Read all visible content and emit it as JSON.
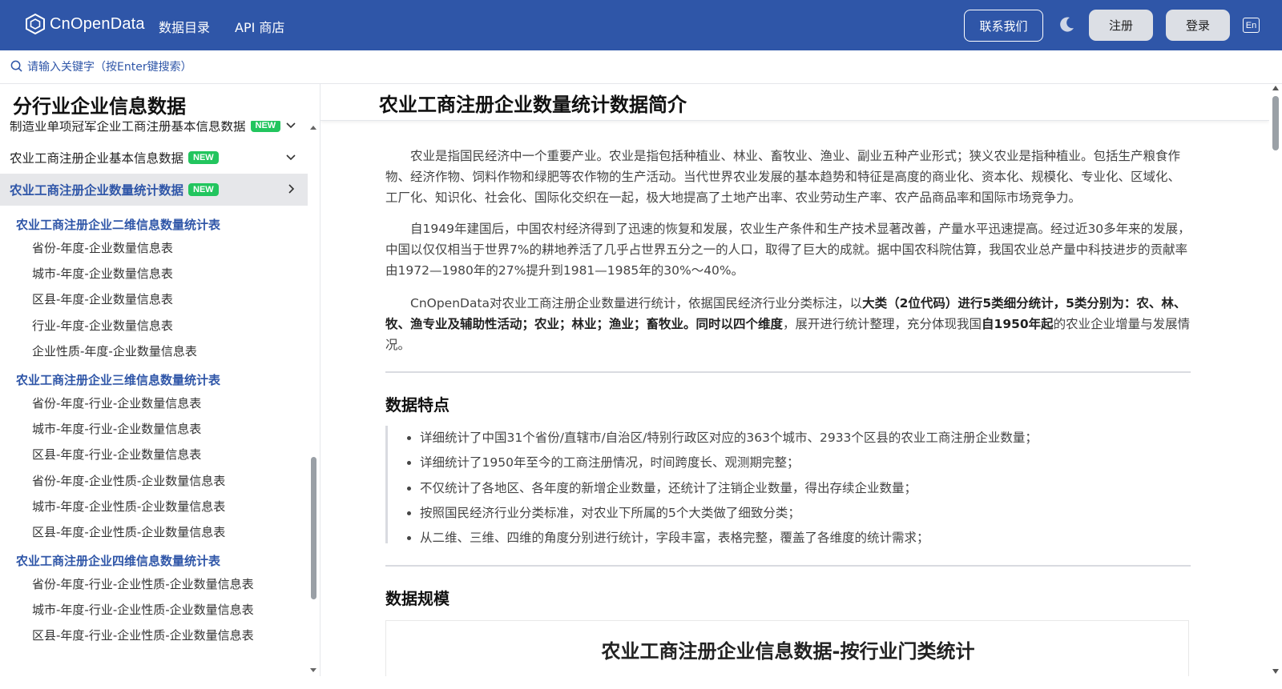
{
  "header": {
    "logo_text": "CnOpenData",
    "nav": [
      "数据目录",
      "API 商店"
    ],
    "contact_label": "联系我们",
    "register_label": "注册",
    "login_label": "登录",
    "lang_label": "En"
  },
  "search": {
    "placeholder": "请输入关键字（按Enter键搜索）"
  },
  "sidebar": {
    "title": "分行业企业信息数据",
    "menu": [
      {
        "label": "制造业单项冠军企业工商注册基本信息数据",
        "badge": "NEW"
      },
      {
        "label": "农业工商注册企业基本信息数据",
        "badge": "NEW"
      },
      {
        "label": "农业工商注册企业数量统计数据",
        "badge": "NEW"
      }
    ],
    "groups": [
      {
        "title": "农业工商注册企业二维信息数量统计表",
        "items": [
          "省份-年度-企业数量信息表",
          "城市-年度-企业数量信息表",
          "区县-年度-企业数量信息表",
          "行业-年度-企业数量信息表",
          "企业性质-年度-企业数量信息表"
        ]
      },
      {
        "title": "农业工商注册企业三维信息数量统计表",
        "items": [
          "省份-年度-行业-企业数量信息表",
          "城市-年度-行业-企业数量信息表",
          "区县-年度-行业-企业数量信息表",
          "省份-年度-企业性质-企业数量信息表",
          "城市-年度-企业性质-企业数量信息表",
          "区县-年度-企业性质-企业数量信息表"
        ]
      },
      {
        "title": "农业工商注册企业四维信息数量统计表",
        "items": [
          "省份-年度-行业-企业性质-企业数量信息表",
          "城市-年度-行业-企业性质-企业数量信息表",
          "区县-年度-行业-企业性质-企业数量信息表"
        ]
      }
    ]
  },
  "main": {
    "title": "农业工商注册企业数量统计数据简介",
    "p1": "农业是指国民经济中一个重要产业。农业是指包括种植业、林业、畜牧业、渔业、副业五种产业形式；狭义农业是指种植业。包括生产粮食作物、经济作物、饲料作物和绿肥等农作物的生产活动。当代世界农业发展的基本趋势和特征是高度的商业化、资本化、规模化、专业化、区域化、工厂化、知识化、社会化、国际化交织在一起，极大地提高了土地产出率、农业劳动生产率、农产品商品率和国际市场竞争力。",
    "p2": "自1949年建国后，中国农村经济得到了迅速的恢复和发展，农业生产条件和生产技术显著改善，产量水平迅速提高。经过近30多年来的发展，中国以仅仅相当于世界7%的耕地养活了几乎占世界五分之一的人口，取得了巨大的成就。据中国农科院估算，我国农业总产量中科技进步的贡献率由1972—1980年的27%提升到1981—1985年的30%～40%。",
    "p3": {
      "t1": "CnOpenData对农业工商注册企业数量进行统计，依据国民经济行业分类标注，以",
      "b1": "大类（2位代码）进行5类细分统计，5类分别为：农、林、牧、渔专业及辅助性活动；农业；林业；渔业；畜牧业。同时以四个维度",
      "t2": "，展开进行统计整理，充分体现我国",
      "b2": "自1950年起",
      "t3": "的农业企业增量与发展情况。"
    },
    "features_title": "数据特点",
    "features": [
      "详细统计了中国31个省份/直辖市/自治区/特别行政区对应的363个城市、2933个区县的农业工商注册企业数量；",
      "详细统计了1950年至今的工商注册情况，时间跨度长、观测期完整；",
      "不仅统计了各地区、各年度的新增企业数量，还统计了注销企业数量，得出存续企业数量；",
      "按照国民经济行业分类标准，对农业下所属的5个大类做了细致分类；",
      "从二维、三维、四维的角度分别进行统计，字段丰富，表格完整，覆盖了各维度的统计需求；"
    ],
    "scale_title": "数据规模",
    "table_title": "农业工商注册企业信息数据-按行业门类统计"
  }
}
